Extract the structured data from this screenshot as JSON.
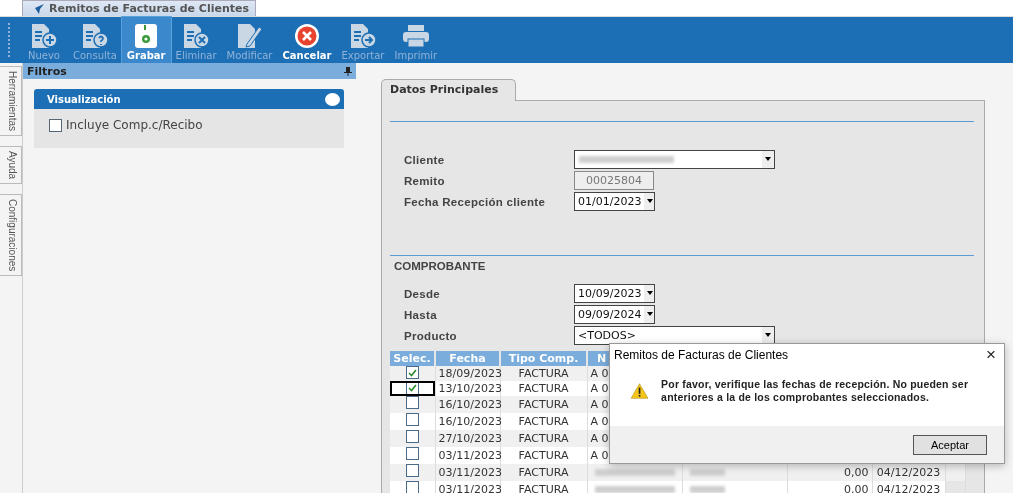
{
  "window": {
    "title": "Remitos de Facturas de Clientes"
  },
  "toolbar": [
    {
      "label": "Nuevo",
      "kind": "new",
      "disabled": true,
      "selected": false
    },
    {
      "label": "Consulta",
      "kind": "query",
      "disabled": true,
      "selected": false
    },
    {
      "label": "Grabar",
      "kind": "save",
      "disabled": false,
      "selected": true
    },
    {
      "label": "Eliminar",
      "kind": "delete",
      "disabled": true,
      "selected": false
    },
    {
      "label": "Modificar",
      "kind": "edit",
      "disabled": true,
      "selected": false
    },
    {
      "label": "Cancelar",
      "kind": "cancel",
      "disabled": false,
      "selected": false
    },
    {
      "label": "Exportar",
      "kind": "export",
      "disabled": true,
      "selected": false
    },
    {
      "label": "Imprimir",
      "kind": "print",
      "disabled": true,
      "selected": false
    }
  ],
  "side_tabs": [
    "Herramientas",
    "Ayuda",
    "Configuraciones"
  ],
  "filters": {
    "title": "Filtros",
    "section": "Visualización",
    "option": {
      "label": "Incluye Comp.c/Recibo",
      "checked": false
    }
  },
  "form": {
    "tab": "Datos Principales",
    "fields": [
      {
        "label": "Cliente",
        "kind": "combo"
      },
      {
        "label": "Remito",
        "kind": "readonly",
        "value": "00025804"
      },
      {
        "label": "Fecha Recepción cliente",
        "kind": "date",
        "value": "01/01/2023"
      }
    ],
    "section": "COMPROBANTE",
    "filters": [
      {
        "label": "Desde",
        "kind": "date",
        "value": "10/09/2023"
      },
      {
        "label": "Hasta",
        "kind": "date",
        "value": "09/09/2024"
      },
      {
        "label": "Producto",
        "kind": "combo",
        "value": "<TODOS>"
      }
    ]
  },
  "table": {
    "columns": [
      "Selec.",
      "Fecha",
      "Tipo Comp.",
      "N"
    ],
    "rows": [
      {
        "checked": true,
        "focused": false,
        "fecha": "18/09/2023",
        "tipo": "FACTURA",
        "numero": "A 0"
      },
      {
        "checked": true,
        "focused": true,
        "fecha": "13/10/2023",
        "tipo": "FACTURA",
        "numero": "A 0"
      },
      {
        "checked": false,
        "focused": false,
        "fecha": "16/10/2023",
        "tipo": "FACTURA",
        "numero": "A 0"
      },
      {
        "checked": false,
        "focused": false,
        "fecha": "16/10/2023",
        "tipo": "FACTURA",
        "numero": "A 0"
      },
      {
        "checked": false,
        "focused": false,
        "fecha": "27/10/2023",
        "tipo": "FACTURA",
        "numero": "A 0"
      },
      {
        "checked": false,
        "focused": false,
        "fecha": "03/11/2023",
        "tipo": "FACTURA",
        "numero": "A 0"
      },
      {
        "checked": false,
        "focused": false,
        "fecha": "03/11/2023",
        "tipo": "FACTURA",
        "importe": "0,00",
        "vencimiento": "04/12/2023"
      },
      {
        "checked": false,
        "focused": false,
        "fecha": "03/11/2023",
        "tipo": "FACTURA",
        "importe": "0,00",
        "vencimiento": "04/12/2023"
      }
    ]
  },
  "dialog": {
    "title": "Remitos de Facturas de Clientes",
    "close": "×",
    "message": "Por favor, verifique las fechas de recepción. No pueden ser anteriores a la de los comprobantes seleccionados.",
    "button": "Aceptar"
  }
}
